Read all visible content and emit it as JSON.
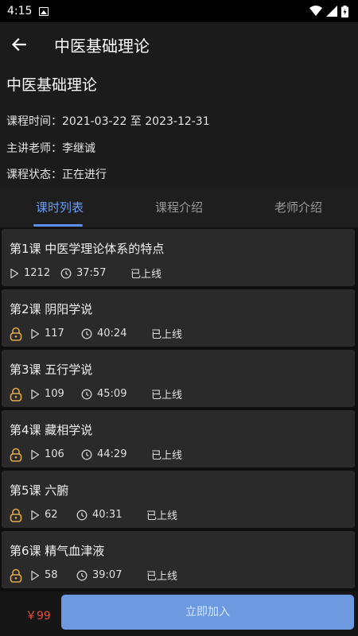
{
  "status_bar": {
    "time": "4:15"
  },
  "app_bar": {
    "title": "中医基础理论"
  },
  "course": {
    "name": "中医基础理论",
    "time_line": "课程时间：2021-03-22 至 2023-12-31",
    "teacher_line": "主讲老师：李继诚",
    "status_line": "课程状态：正在进行"
  },
  "tabs": [
    {
      "label": "课时列表",
      "active": true
    },
    {
      "label": "课程介绍",
      "active": false
    },
    {
      "label": "老师介绍",
      "active": false
    }
  ],
  "lessons": [
    {
      "title": "第1课 中医学理论体系的特点",
      "plays": "1212",
      "duration": "37:57",
      "status": "已上线",
      "locked": false
    },
    {
      "title": "第2课 阴阳学说",
      "plays": "117",
      "duration": "40:24",
      "status": "已上线",
      "locked": true
    },
    {
      "title": "第3课 五行学说",
      "plays": "109",
      "duration": "45:09",
      "status": "已上线",
      "locked": true
    },
    {
      "title": "第4课 藏相学说",
      "plays": "106",
      "duration": "44:29",
      "status": "已上线",
      "locked": true
    },
    {
      "title": "第5课 六腑",
      "plays": "62",
      "duration": "40:31",
      "status": "已上线",
      "locked": true
    },
    {
      "title": "第6课 精气血津液",
      "plays": "58",
      "duration": "39:07",
      "status": "已上线",
      "locked": true
    }
  ],
  "bottom": {
    "price": "￥99",
    "join_label": "立即加入"
  },
  "colors": {
    "accent": "#6b9df7",
    "button": "#6d99e0",
    "price": "#e84a3a",
    "lock": "#e0a94a"
  }
}
